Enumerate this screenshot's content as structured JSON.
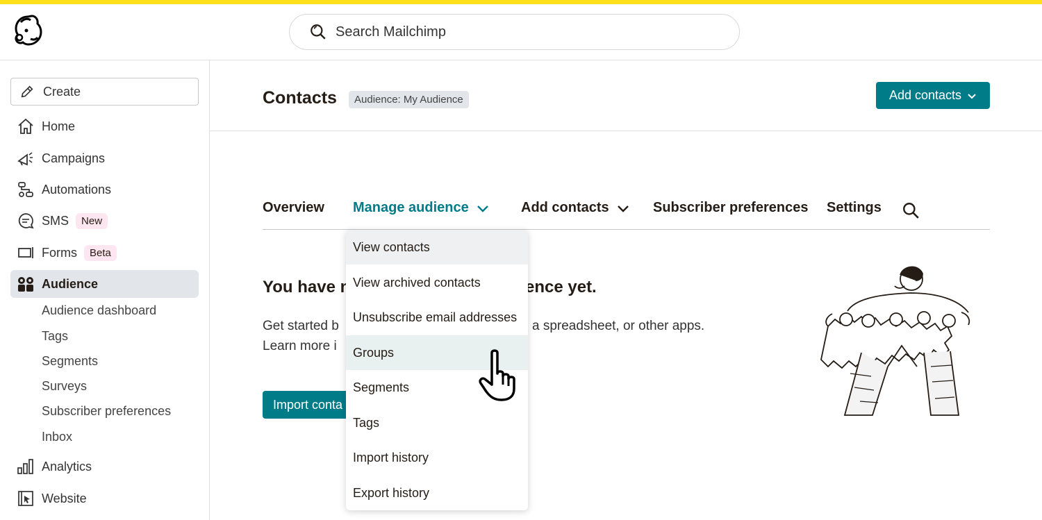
{
  "search": {
    "placeholder": "Search Mailchimp"
  },
  "sidebar": {
    "create_label": "Create",
    "items": [
      {
        "label": "Home"
      },
      {
        "label": "Campaigns"
      },
      {
        "label": "Automations"
      },
      {
        "label": "SMS",
        "badge": "New"
      },
      {
        "label": "Forms",
        "badge": "Beta"
      },
      {
        "label": "Audience"
      }
    ],
    "audience_sub": [
      "Audience dashboard",
      "Tags",
      "Segments",
      "Surveys",
      "Subscriber preferences",
      "Inbox"
    ],
    "bottom_items": [
      {
        "label": "Analytics"
      },
      {
        "label": "Website"
      }
    ]
  },
  "header": {
    "title": "Contacts",
    "audience_tag": "Audience: My Audience",
    "add_contacts_button": "Add contacts"
  },
  "tabs": [
    {
      "label": "Overview"
    },
    {
      "label": "Manage audience"
    },
    {
      "label": "Add contacts"
    },
    {
      "label": "Subscriber preferences"
    },
    {
      "label": "Settings"
    }
  ],
  "empty_state": {
    "title_start": "You have n",
    "title_end": "ence yet.",
    "text_line1_start": "Get started b",
    "text_line1_end": "a spreadsheet, or other apps.",
    "text_line2_start": "Learn more i",
    "import_button": "Import conta"
  },
  "dropdown": {
    "items": [
      "View contacts",
      "View archived contacts",
      "Unsubscribe email addresses",
      "Groups",
      "Segments",
      "Tags",
      "Import history",
      "Export history"
    ]
  },
  "colors": {
    "accent": "#007c89",
    "brand_yellow": "#ffe01b",
    "text": "#241c15",
    "badge_bg": "#fde6ef"
  }
}
